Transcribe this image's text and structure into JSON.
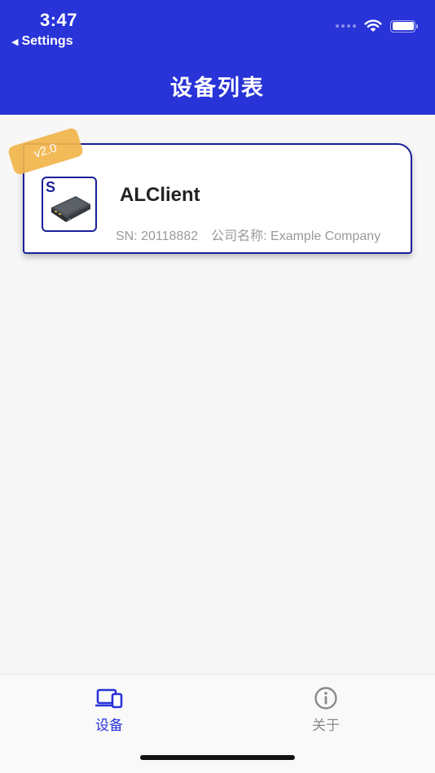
{
  "status_bar": {
    "time": "3:47",
    "back_label": "Settings"
  },
  "header": {
    "title": "设备列表"
  },
  "devices": [
    {
      "version": "v2.0",
      "thumb_letter": "S",
      "name": "ALClient",
      "sn": "SN: 20118882",
      "company": "公司名称: Example Company"
    }
  ],
  "tabbar": {
    "devices_label": "设备",
    "about_label": "关于"
  },
  "colors": {
    "primary": "#2833d8",
    "card_border": "#1a1f9a",
    "badge": "#f2b54a"
  }
}
